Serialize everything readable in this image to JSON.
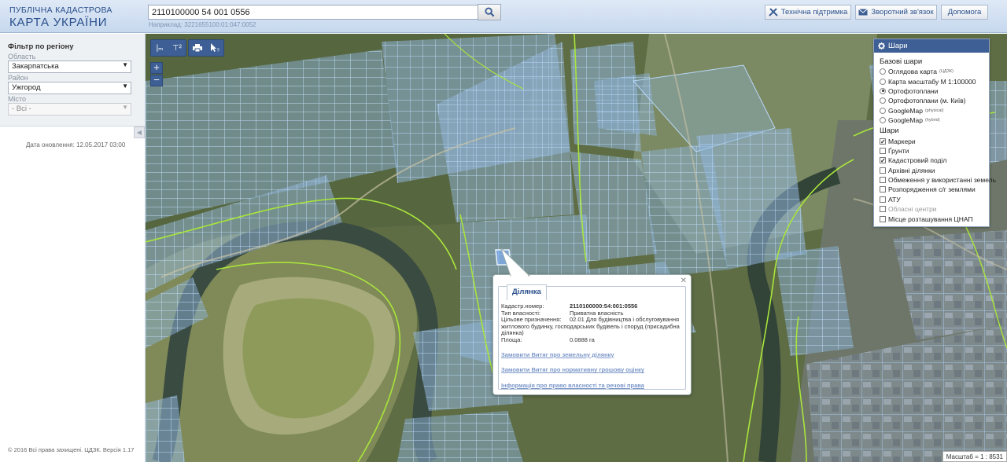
{
  "header": {
    "brand_line1": "ПУБЛІЧНА КАДАСТРОВА",
    "brand_line2": "КАРТА УКРАЇНИ",
    "search_value": "2110100000 54 001 0556",
    "search_hint": "Наприклад: 3221655100:01:047:0052",
    "support_label": "Технічна підтримка",
    "feedback_label": "Зворотний зв'язок",
    "help_label": "Допомога"
  },
  "filter": {
    "title": "Фільтр по регіону",
    "oblast_label": "Область",
    "oblast_value": "Закарпатська",
    "raion_label": "Район",
    "raion_value": "Ужгород",
    "misto_label": "Місто",
    "misto_value": "- Всі -"
  },
  "update_date": "Дата оновлення: 12.05.2017 03:00",
  "copyright": "© 2016 Всі права захищені. ЦДЗК. Версія 1.17",
  "layers": {
    "title": "Шари",
    "base_title": "Базові шари",
    "base": [
      {
        "label": "Оглядова карта",
        "sup": "(ЦДЗК)",
        "selected": false
      },
      {
        "label": "Карта масштабу М 1:100000",
        "sup": "",
        "selected": false
      },
      {
        "label": "Ортофотоплани",
        "sup": "",
        "selected": true
      },
      {
        "label": "Ортофотоплани (м. Київ)",
        "sup": "",
        "selected": false
      },
      {
        "label": "GoogleMap",
        "sup": "(physical)",
        "selected": false
      },
      {
        "label": "GoogleMap",
        "sup": "(hybrid)",
        "selected": false
      }
    ],
    "overlay_title": "Шари",
    "overlays": [
      {
        "label": "Маркери",
        "checked": true,
        "disabled": false
      },
      {
        "label": "Ґрунти",
        "checked": false,
        "disabled": false
      },
      {
        "label": "Кадастровий поділ",
        "checked": true,
        "disabled": false
      },
      {
        "label": "Архівні ділянки",
        "checked": false,
        "disabled": false
      },
      {
        "label": "Обмеження у використанні земель",
        "checked": false,
        "disabled": false
      },
      {
        "label": "Розпорядження с/г землями",
        "checked": false,
        "disabled": false
      },
      {
        "label": "АТУ",
        "checked": false,
        "disabled": false
      },
      {
        "label": "Обласні центри",
        "checked": false,
        "disabled": true
      },
      {
        "label": "Місце розташування ЦНАП",
        "checked": false,
        "disabled": false
      }
    ]
  },
  "popup": {
    "tab_label": "Ділянка",
    "rows": [
      {
        "key": "Кадастр.номер:",
        "value": "2110100000:54:001:0556",
        "bold": true
      },
      {
        "key": "Тип власності:",
        "value": "Приватна власність",
        "bold": false
      },
      {
        "key": "Цільове призначення:",
        "value": "02.01 Для будівництва і обслуговування",
        "bold": false
      }
    ],
    "purpose_cont": "житлового будинку, господарських будівель і споруд (присадибна ділянка)",
    "area_key": "Площа:",
    "area_value": "0.0888 га",
    "links": [
      "Замовити Витяг про земельну ділянку",
      "Замовити Витяг про нормативну грошову оцінку",
      "Інформація про право власності та речові права"
    ]
  },
  "map": {
    "scale_text": "Масштаб = 1 : 8531",
    "zoom_in": "+",
    "zoom_out": "−"
  }
}
